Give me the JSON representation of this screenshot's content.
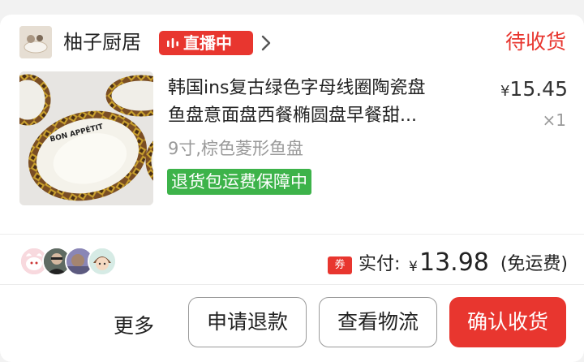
{
  "order": {
    "shop": {
      "name": "柚子厨居",
      "live_label": "直播中",
      "avatar_icon": "shop-avatar-icon"
    },
    "status": "待收货",
    "item": {
      "title_line1": "韩国ins复古绿色字母线圈陶瓷盘",
      "title_line2": "鱼盘意面盘西餐椭圆盘早餐甜...",
      "price_currency": "¥",
      "price_value": "15.45",
      "quantity": "×1",
      "spec": "9寸,棕色菱形鱼盘",
      "guarantee": "退货包运费保障中",
      "image_text": "BON APPÉTIT"
    },
    "payment": {
      "coupon_tag": "券",
      "label": "实付:",
      "currency": "¥",
      "amount": "13.98",
      "note": "(免运费)"
    },
    "actions": {
      "more": "更多",
      "refund": "申请退款",
      "logistics": "查看物流",
      "confirm": "确认收货"
    }
  },
  "colors": {
    "accent": "#e8362f",
    "guarantee": "#3db34a",
    "muted": "#999999"
  }
}
